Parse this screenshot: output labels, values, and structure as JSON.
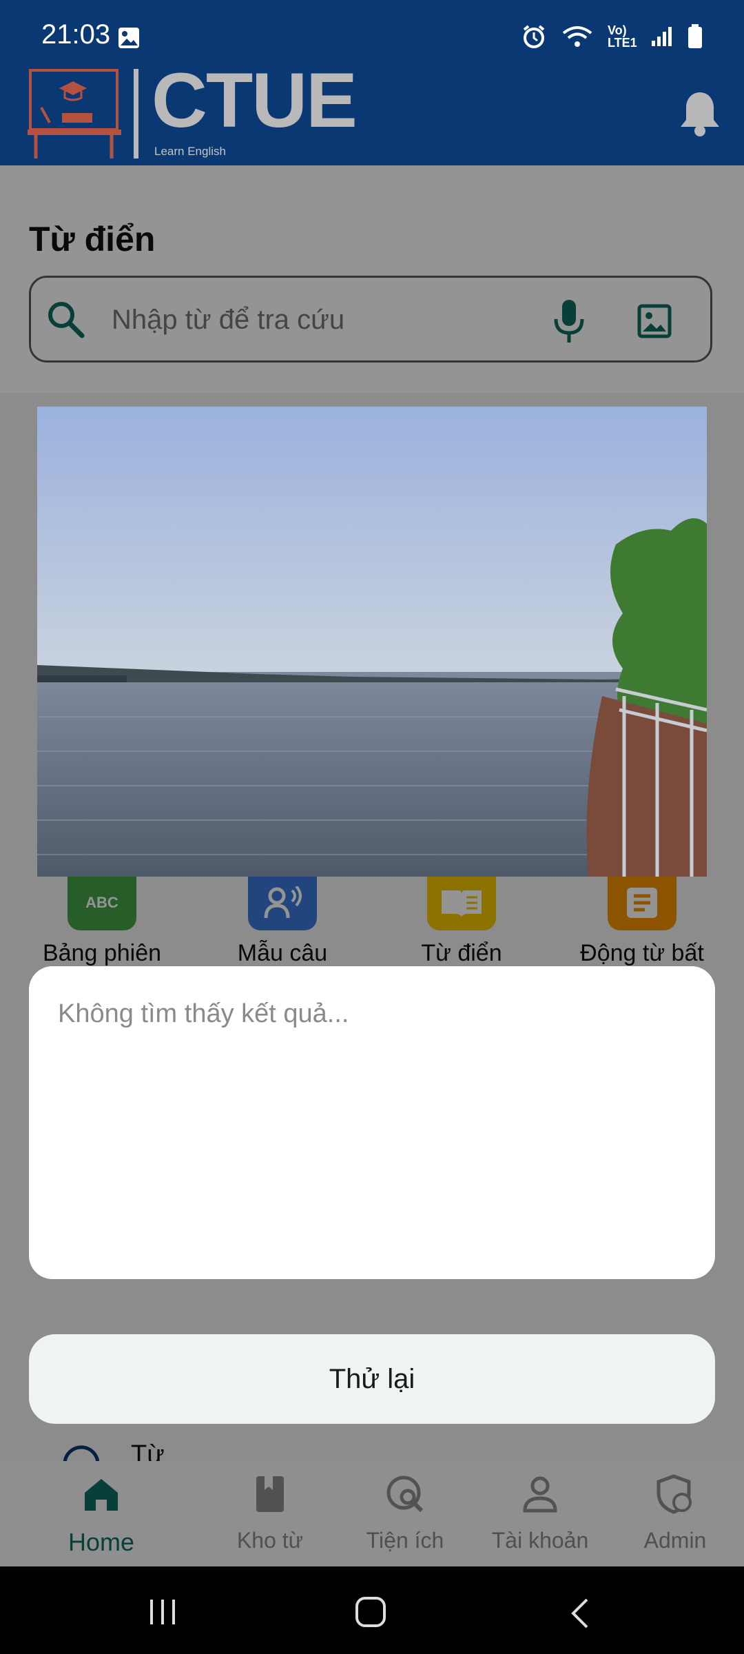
{
  "status_bar": {
    "time": "21:03",
    "network_label": "Vo) LTE1"
  },
  "header": {
    "logo_text": "CTUE",
    "logo_sub": "Learn English",
    "icons": [
      "bell-icon"
    ]
  },
  "page": {
    "title": "Từ điển",
    "search_placeholder": "Nhập từ để tra cứu",
    "categories": [
      {
        "label": "Bảng phiên",
        "icon": "abc-icon",
        "icon_text": "ABC",
        "color": "#43a047"
      },
      {
        "label": "Mẫu câu",
        "icon": "speaking-person-icon",
        "color": "#3d78d8"
      },
      {
        "label": "Từ điển",
        "icon": "book-icon",
        "color": "#f2c500"
      },
      {
        "label": "Động từ bất",
        "icon": "document-icon",
        "color": "#f39200"
      }
    ],
    "list_item": "Từ điển"
  },
  "dialog": {
    "result_text": "Không tìm thấy kết quả...",
    "retry_label": "Thử lại"
  },
  "bottom_nav": {
    "items": [
      {
        "label": "Home",
        "icon": "home-icon",
        "active": true
      },
      {
        "label": "Kho từ",
        "icon": "bookmark-book-icon",
        "active": false
      },
      {
        "label": "Tiện ích",
        "icon": "globe-search-icon",
        "active": false
      },
      {
        "label": "Tài khoản",
        "icon": "person-icon",
        "active": false
      },
      {
        "label": "Admin",
        "icon": "admin-shield-icon",
        "active": false
      }
    ]
  },
  "colors": {
    "header": "#0a3873",
    "accent": "#0e6e63",
    "search_icon": "#0e6e63"
  }
}
